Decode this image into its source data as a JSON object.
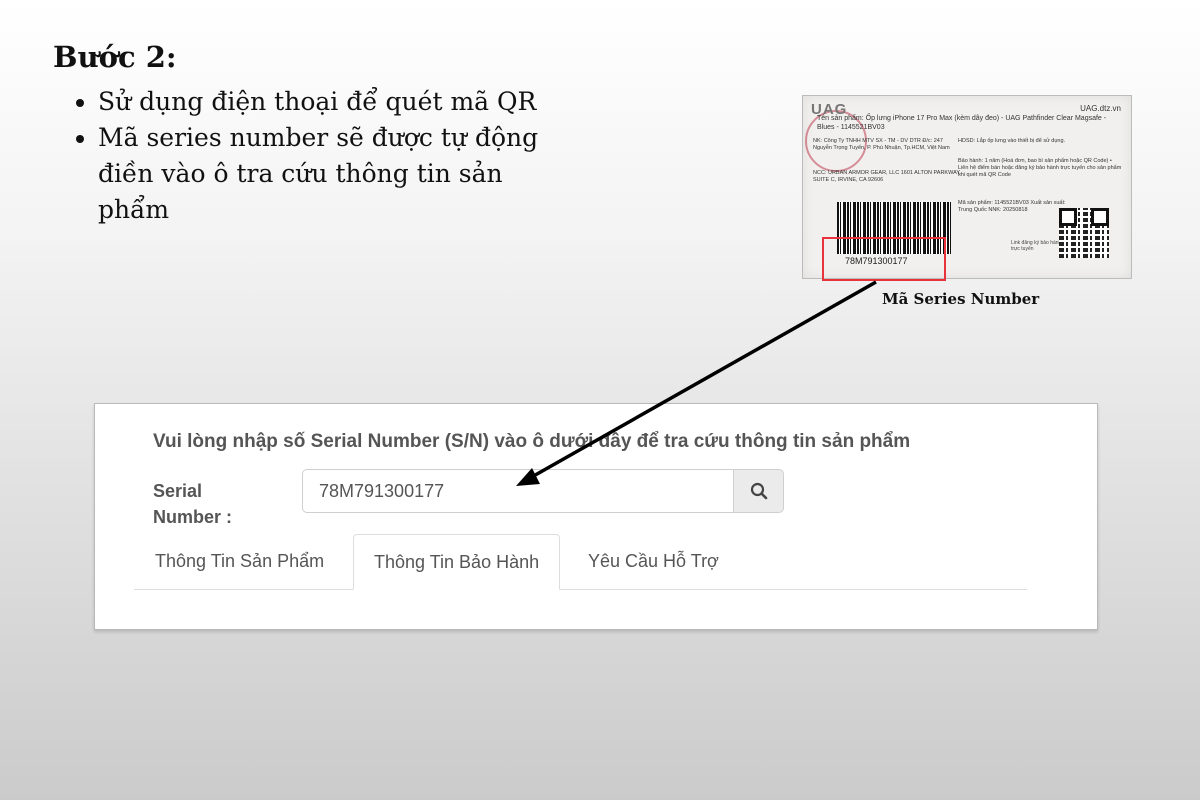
{
  "step": {
    "title": "Bước 2:",
    "bullets": [
      "Sử dụng điện thoại để quét mã QR",
      "Mã series number sẽ được tự động điền vào ô tra cứu thông tin sản phẩm"
    ]
  },
  "label": {
    "logo": "UAG",
    "site": "UAG.dtz.vn",
    "product_name": "Tên sản phẩm: Ốp lưng iPhone 17 Pro Max (kèm dây đeo) - UAG Pathfinder Clear Magsafe - Blues - 1145521BV03",
    "importer": "NK: Công Ty TNHH MTV SX - TM - DV DTR Đ/c: 247 Nguyễn Trọng Tuyển, P. Phú Nhuận, Tp.HCM, Việt Nam",
    "usage": "HDSD: Lắp ốp lưng vào thiết bị để sử dụng.",
    "manufacturer": "NCC: URBAN ARMOR GEAR, LLC 1601 ALTON PARKWAY, SUITE C, IRVINE, CA 92606",
    "warranty": "Bảo hành: 1 năm (Hoá đơn, bao bì sản phẩm hoặc QR Code) • Liên hệ điểm bán hoặc đăng ký bảo hành trực tuyến cho sản phẩm khi quét mã QR Code",
    "product_code": "Mã sản phẩm: 1145521BV03 Xuất sản xuất: Trung Quốc NNK: 20250818",
    "register": "Link đăng ký bảo hành trực tuyến",
    "barcode_number": "78M791300177",
    "caption": "Mã Series Number"
  },
  "lookup": {
    "prompt": "Vui lòng nhập số Serial Number (S/N) vào ô dưới đây để tra cứu thông tin sản phẩm",
    "field_label": "Serial Number :",
    "serial_value": "78M791300177",
    "tabs": [
      {
        "label": "Thông Tin Sản Phẩm",
        "active": false
      },
      {
        "label": "Thông Tin Bảo Hành",
        "active": true
      },
      {
        "label": "Yêu Cầu Hỗ Trợ",
        "active": false
      }
    ]
  },
  "colors": {
    "highlight": "#e8323c",
    "arrow": "#000000",
    "text_muted": "#555555"
  },
  "icons": {
    "search": "search-icon",
    "arrow": "pointer-arrow-icon"
  }
}
